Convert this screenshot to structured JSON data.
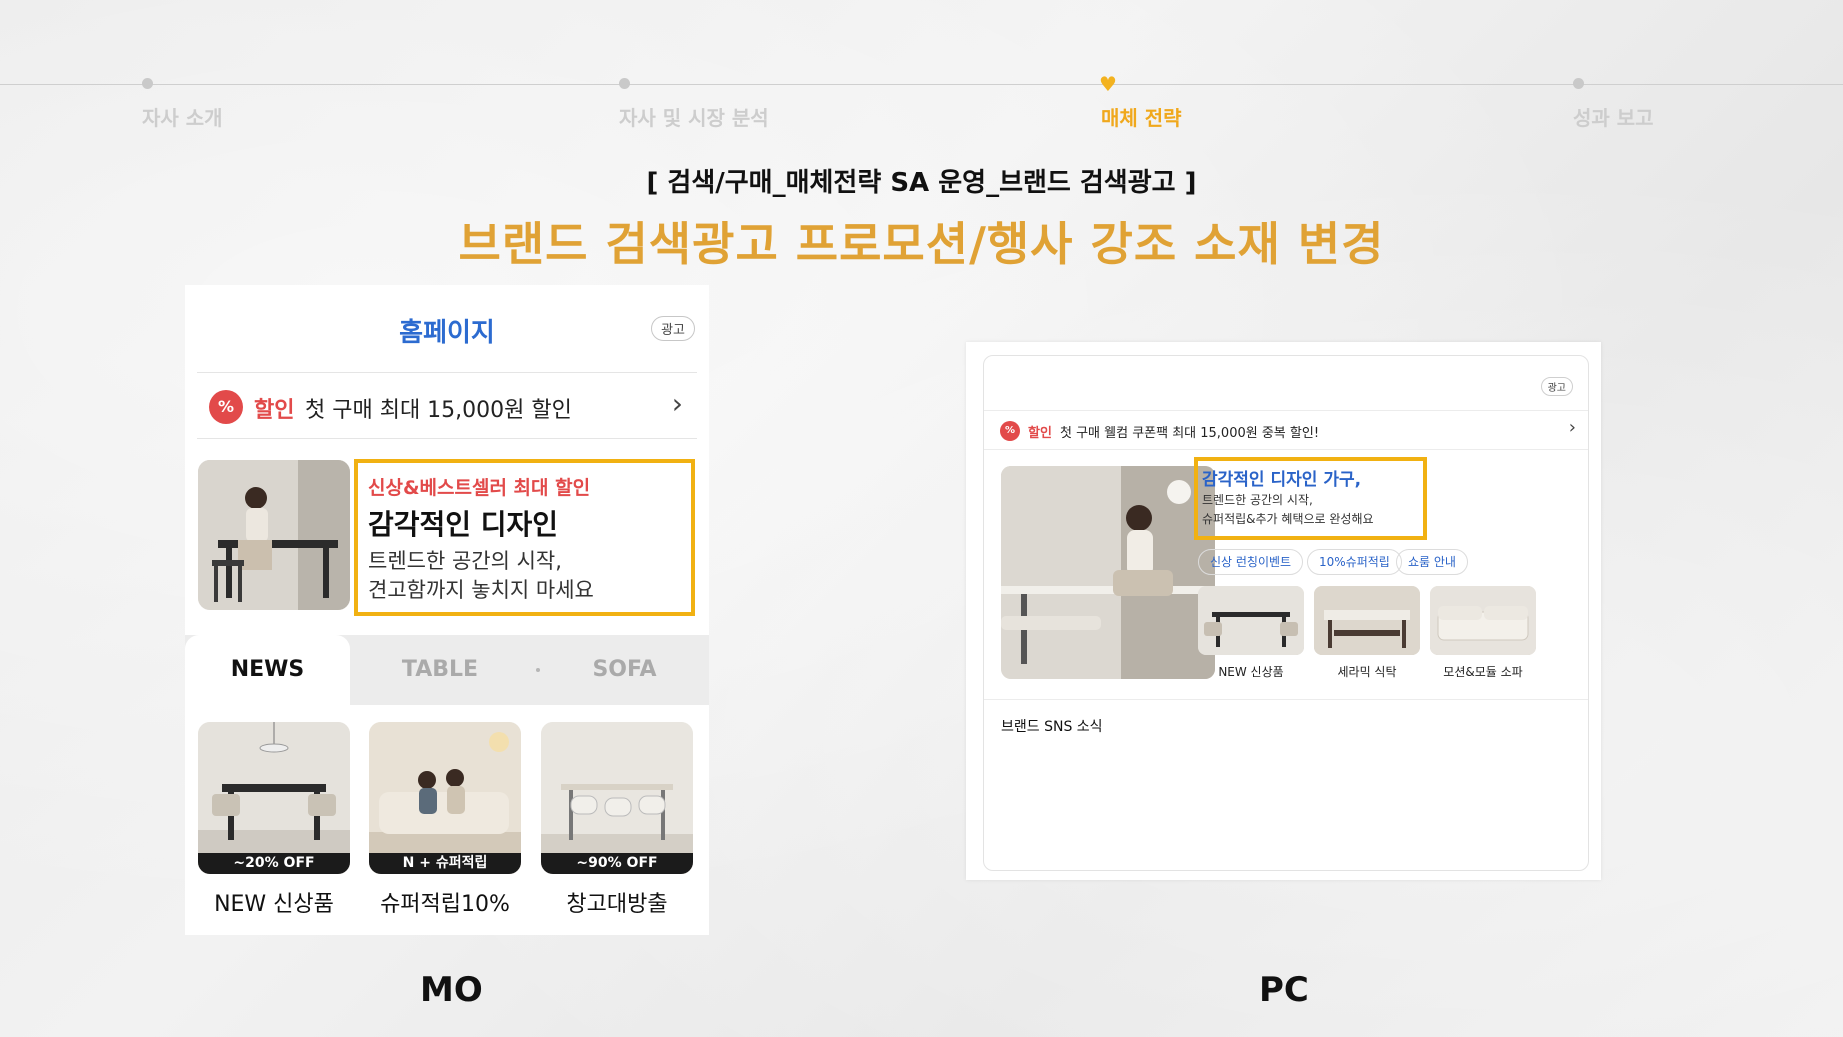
{
  "progress": {
    "steps": [
      {
        "label": "자사 소개",
        "active": false
      },
      {
        "label": "자사 및 시장 분석",
        "active": false
      },
      {
        "label": "매체 전략",
        "active": true
      },
      {
        "label": "성과 보고",
        "active": false
      }
    ]
  },
  "header": {
    "subtitle": "[ 검색/구매_매체전략 SA 운영_브랜드 검색광고 ]",
    "title": "브랜드 검색광고 프로모션/행사 강조 소재 변경"
  },
  "mo": {
    "caption": "MO",
    "homepage_label": "홈페이지",
    "ad_label": "광고",
    "promo": {
      "tag": "할인",
      "text": "첫 구매 최대 15,000원 할인"
    },
    "highlight": {
      "line1": "신상&베스트셀러 최대 할인",
      "line2": "감각적인 디자인",
      "line3": "트렌드한 공간의 시작,",
      "line4": "견고함까지 놓치지 마세요"
    },
    "tabs": [
      {
        "label": "NEWS",
        "active": true
      },
      {
        "label": "TABLE",
        "active": false
      },
      {
        "label": "SOFA",
        "active": false
      }
    ],
    "cards": [
      {
        "badge": "~20% OFF",
        "caption": "NEW 신상품"
      },
      {
        "badge": "N + 슈퍼적립",
        "caption": "슈퍼적립10%"
      },
      {
        "badge": "~90% OFF",
        "caption": "창고대방출"
      }
    ]
  },
  "pc": {
    "caption": "PC",
    "ad_label": "광고",
    "promo": {
      "tag": "할인",
      "text": "첫 구매 웰컴 쿠폰팩 최대 15,000원 중복 할인!"
    },
    "highlight": {
      "line1": "감각적인 디자인 가구,",
      "line2": "트렌드한 공간의 시작,",
      "line3": "슈퍼적립&추가 혜택으로 완성해요"
    },
    "chips": [
      "신상 런칭이벤트",
      "10%슈퍼적립",
      "쇼룸 안내"
    ],
    "thumbs": [
      "NEW 신상품",
      "세라믹 식탁",
      "모션&모듈 소파"
    ],
    "sns_label": "브랜드 SNS 소식"
  },
  "colors": {
    "accent": "#e0a235",
    "highlight_border": "#f1b112",
    "discount_red": "#e24a4a",
    "link_blue": "#2a63c8"
  }
}
